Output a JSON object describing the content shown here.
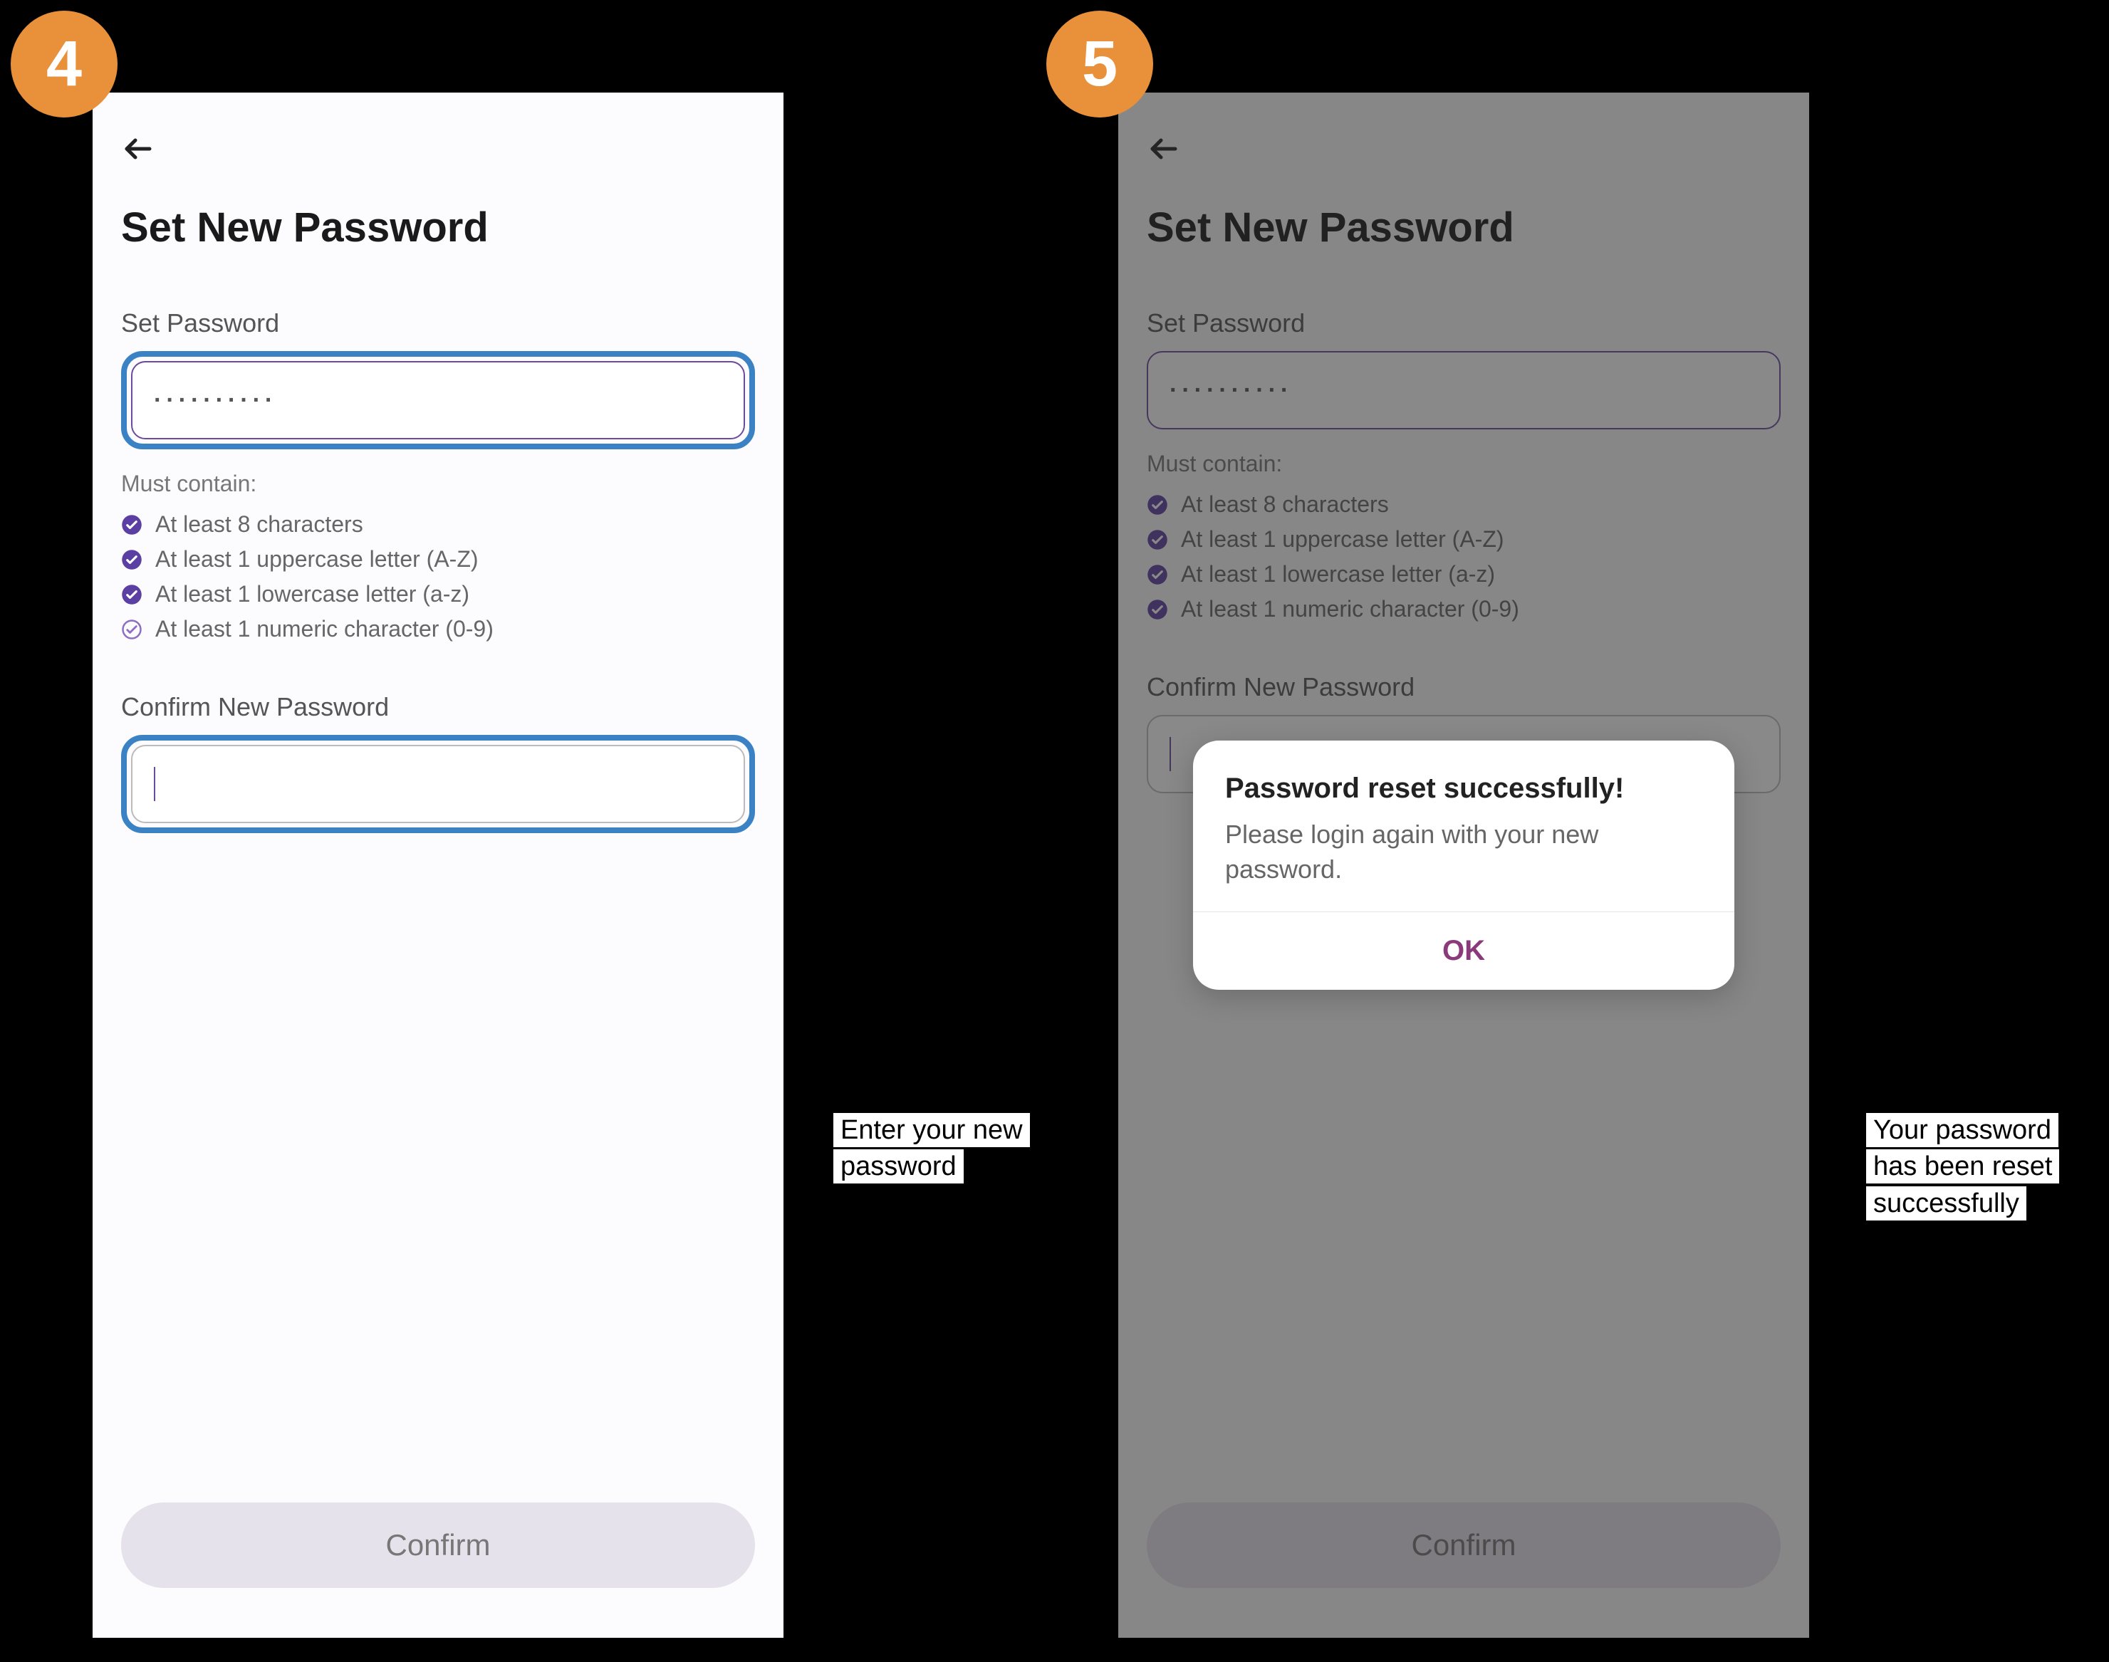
{
  "steps": {
    "s1": {
      "badge": "4",
      "annotation": "Enter your new password"
    },
    "s2": {
      "badge": "5",
      "annotation": "Your password has been reset successfully"
    }
  },
  "screen": {
    "title": "Set New Password",
    "set_label": "Set Password",
    "password_value": "··········",
    "must_contain_label": "Must contain:",
    "rules": {
      "r1": "At least 8 characters",
      "r2": "At least 1 uppercase letter (A-Z)",
      "r3": "At least 1 lowercase letter (a-z)",
      "r4": "At least 1 numeric character (0-9)"
    },
    "confirm_label": "Confirm New Password",
    "confirm_button": "Confirm"
  },
  "modal": {
    "title": "Password reset successfully!",
    "body": "Please login again with your new password.",
    "ok": "OK"
  }
}
